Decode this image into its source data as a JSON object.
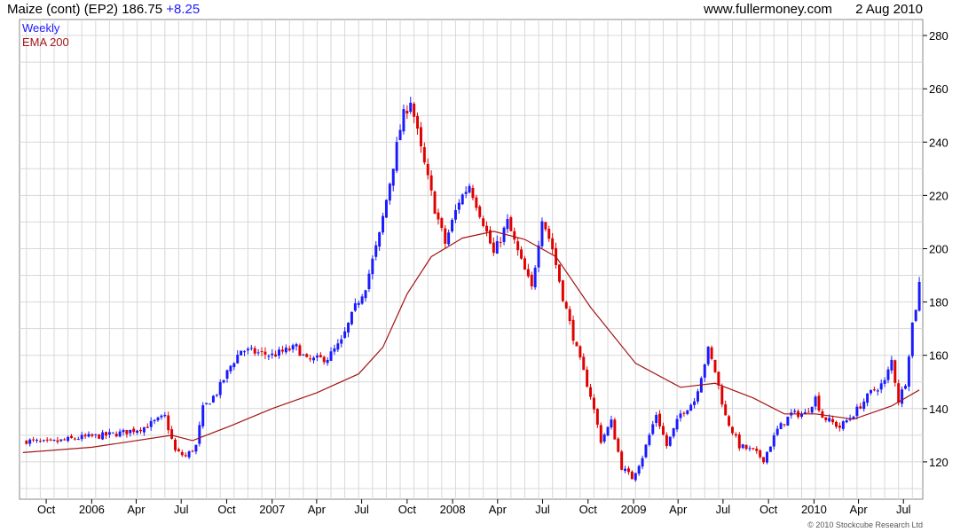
{
  "header": {
    "instrument": "Maize (cont) (EP2)",
    "price": "186.75",
    "change": "+8.25",
    "site": "www.fullermoney.com",
    "date": "2 Aug 2010"
  },
  "footer": {
    "copyright": "© 2010 Stockcube Research Ltd"
  },
  "colors": {
    "up": "#1a1aff",
    "down": "#e00000",
    "ema": "#a31515",
    "grid": "#d8d8d8"
  },
  "chart_data": {
    "type": "candlestick",
    "legend": [
      {
        "label": "Weekly",
        "color": "#1a1aff"
      },
      {
        "label": "EMA 200",
        "color": "#a31515"
      }
    ],
    "ylim": [
      106,
      286
    ],
    "y_ticks": [
      120,
      140,
      160,
      180,
      200,
      220,
      240,
      260,
      280
    ],
    "y_axis_side": "right",
    "x_tick_labels": [
      "Oct",
      "2006",
      "Apr",
      "Jul",
      "Oct",
      "2007",
      "Apr",
      "Jul",
      "Oct",
      "2008",
      "Apr",
      "Jul",
      "Oct",
      "2009",
      "Apr",
      "Jul",
      "Oct",
      "2010",
      "Apr",
      "Jul"
    ],
    "grid": true,
    "price_series": [
      {
        "date": "2005-08-22",
        "value": 128
      },
      {
        "date": "2005-10-03",
        "value": 127
      },
      {
        "date": "2005-12-05",
        "value": 129
      },
      {
        "date": "2006-01-30",
        "value": 130
      },
      {
        "date": "2006-03-06",
        "value": 131
      },
      {
        "date": "2006-04-17",
        "value": 133
      },
      {
        "date": "2006-05-29",
        "value": 137
      },
      {
        "date": "2006-06-19",
        "value": 124
      },
      {
        "date": "2006-07-10",
        "value": 122
      },
      {
        "date": "2006-07-31",
        "value": 126
      },
      {
        "date": "2006-08-14",
        "value": 140
      },
      {
        "date": "2006-09-11",
        "value": 146
      },
      {
        "date": "2006-10-09",
        "value": 156
      },
      {
        "date": "2006-10-30",
        "value": 162
      },
      {
        "date": "2007-01-01",
        "value": 160
      },
      {
        "date": "2007-02-19",
        "value": 163
      },
      {
        "date": "2007-03-12",
        "value": 158
      },
      {
        "date": "2007-04-23",
        "value": 159
      },
      {
        "date": "2007-05-21",
        "value": 165
      },
      {
        "date": "2007-06-18",
        "value": 178
      },
      {
        "date": "2007-07-09",
        "value": 186
      },
      {
        "date": "2007-08-06",
        "value": 205
      },
      {
        "date": "2007-08-27",
        "value": 225
      },
      {
        "date": "2007-09-17",
        "value": 245
      },
      {
        "date": "2007-09-24",
        "value": 250
      },
      {
        "date": "2007-10-08",
        "value": 256
      },
      {
        "date": "2007-10-29",
        "value": 237
      },
      {
        "date": "2007-11-26",
        "value": 215
      },
      {
        "date": "2007-12-17",
        "value": 202
      },
      {
        "date": "2008-01-14",
        "value": 218
      },
      {
        "date": "2008-02-04",
        "value": 224
      },
      {
        "date": "2008-03-03",
        "value": 210
      },
      {
        "date": "2008-03-24",
        "value": 198
      },
      {
        "date": "2008-04-21",
        "value": 210
      },
      {
        "date": "2008-05-19",
        "value": 195
      },
      {
        "date": "2008-06-09",
        "value": 185
      },
      {
        "date": "2008-06-30",
        "value": 212
      },
      {
        "date": "2008-07-21",
        "value": 200
      },
      {
        "date": "2008-08-11",
        "value": 182
      },
      {
        "date": "2008-09-08",
        "value": 162
      },
      {
        "date": "2008-10-06",
        "value": 145
      },
      {
        "date": "2008-10-27",
        "value": 128
      },
      {
        "date": "2008-11-17",
        "value": 135
      },
      {
        "date": "2008-12-08",
        "value": 118
      },
      {
        "date": "2008-12-29",
        "value": 114
      },
      {
        "date": "2009-01-19",
        "value": 122
      },
      {
        "date": "2009-02-16",
        "value": 138
      },
      {
        "date": "2009-03-09",
        "value": 126
      },
      {
        "date": "2009-04-06",
        "value": 138
      },
      {
        "date": "2009-05-04",
        "value": 143
      },
      {
        "date": "2009-06-01",
        "value": 162
      },
      {
        "date": "2009-06-15",
        "value": 154
      },
      {
        "date": "2009-07-06",
        "value": 137
      },
      {
        "date": "2009-08-03",
        "value": 126
      },
      {
        "date": "2009-08-31",
        "value": 124
      },
      {
        "date": "2009-09-21",
        "value": 121
      },
      {
        "date": "2009-10-19",
        "value": 132
      },
      {
        "date": "2009-11-16",
        "value": 138
      },
      {
        "date": "2009-12-14",
        "value": 138
      },
      {
        "date": "2010-01-04",
        "value": 144
      },
      {
        "date": "2010-01-18",
        "value": 137
      },
      {
        "date": "2010-02-22",
        "value": 133
      },
      {
        "date": "2010-03-22",
        "value": 138
      },
      {
        "date": "2010-04-26",
        "value": 146
      },
      {
        "date": "2010-05-24",
        "value": 150
      },
      {
        "date": "2010-06-07",
        "value": 158
      },
      {
        "date": "2010-06-21",
        "value": 143
      },
      {
        "date": "2010-07-05",
        "value": 150
      },
      {
        "date": "2010-07-19",
        "value": 172
      },
      {
        "date": "2010-07-26",
        "value": 178
      },
      {
        "date": "2010-08-02",
        "value": 187
      }
    ],
    "ema_series": [
      {
        "date": "2005-08-15",
        "value": 123.5
      },
      {
        "date": "2006-01-02",
        "value": 125.5
      },
      {
        "date": "2006-06-12",
        "value": 130
      },
      {
        "date": "2006-07-24",
        "value": 128
      },
      {
        "date": "2006-10-09",
        "value": 133.5
      },
      {
        "date": "2007-01-01",
        "value": 140
      },
      {
        "date": "2007-04-02",
        "value": 146
      },
      {
        "date": "2007-06-25",
        "value": 153
      },
      {
        "date": "2007-08-13",
        "value": 163
      },
      {
        "date": "2007-10-01",
        "value": 183
      },
      {
        "date": "2007-11-19",
        "value": 197
      },
      {
        "date": "2008-01-21",
        "value": 204
      },
      {
        "date": "2008-03-24",
        "value": 206.5
      },
      {
        "date": "2008-05-26",
        "value": 203.5
      },
      {
        "date": "2008-07-28",
        "value": 197
      },
      {
        "date": "2008-10-06",
        "value": 178
      },
      {
        "date": "2009-01-05",
        "value": 157
      },
      {
        "date": "2009-04-06",
        "value": 148
      },
      {
        "date": "2009-06-15",
        "value": 149.5
      },
      {
        "date": "2009-08-31",
        "value": 144
      },
      {
        "date": "2009-11-02",
        "value": 138
      },
      {
        "date": "2010-01-04",
        "value": 138
      },
      {
        "date": "2010-03-22",
        "value": 136
      },
      {
        "date": "2010-06-07",
        "value": 141
      },
      {
        "date": "2010-08-02",
        "value": 147
      }
    ]
  }
}
